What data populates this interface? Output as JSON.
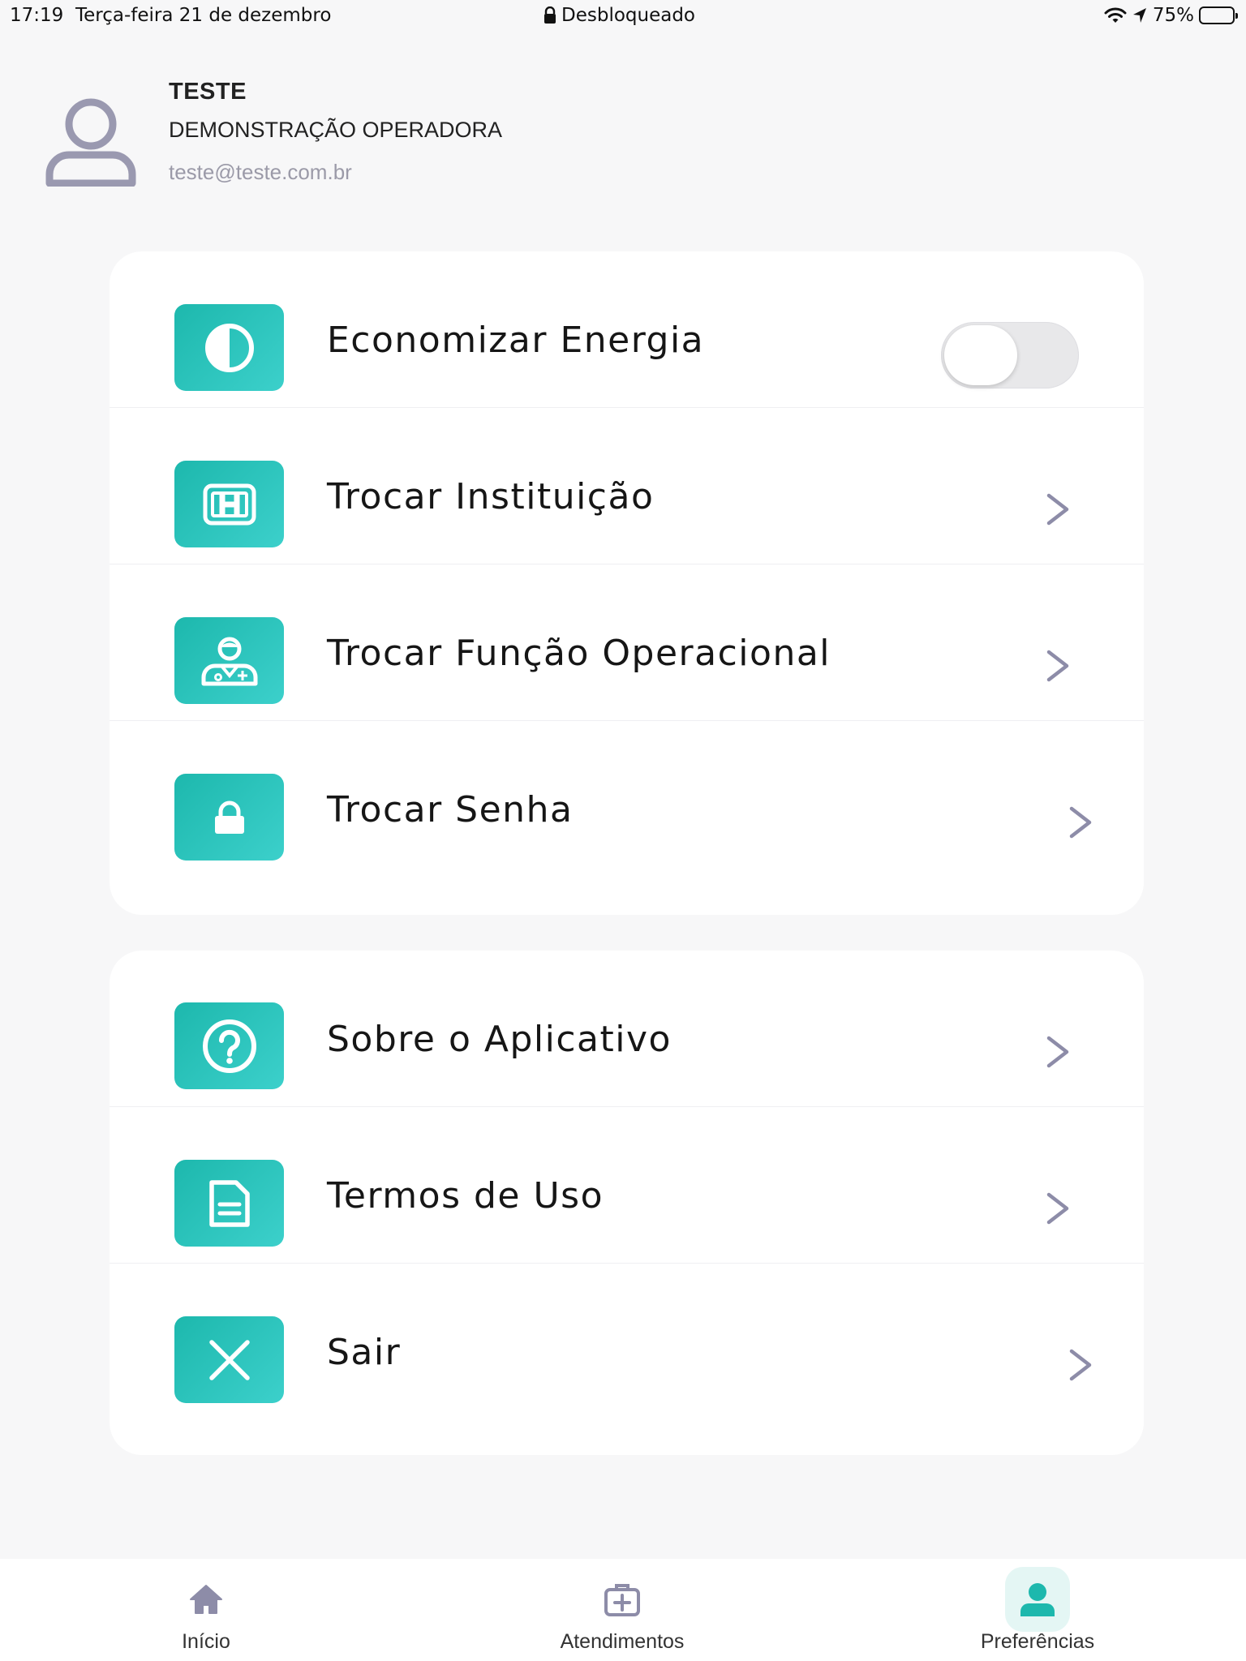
{
  "status_bar": {
    "time": "17:19",
    "date": "Terça-feira 21 de dezembro",
    "lock_status": "Desbloqueado",
    "battery": "75%",
    "battery_level": 0.75
  },
  "profile": {
    "name": "TESTE",
    "organization": "DEMONSTRAÇÃO OPERADORA",
    "email": "teste@teste.com.br"
  },
  "colors": {
    "accent": "#1db8ad",
    "accent_light": "#3cd0cb",
    "chevron": "#8d8ca8",
    "avatar": "#9a99b0"
  },
  "settings_group_1": [
    {
      "label": "Economizar Energia",
      "icon": "half-circle-icon",
      "control": "toggle",
      "toggle_on": false
    },
    {
      "label": "Trocar Instituição",
      "icon": "hospital-icon",
      "control": "chevron"
    },
    {
      "label": "Trocar Função Operacional",
      "icon": "doctor-icon",
      "control": "chevron"
    },
    {
      "label": "Trocar Senha",
      "icon": "lock-icon",
      "control": "chevron"
    }
  ],
  "settings_group_2": [
    {
      "label": "Sobre o Aplicativo",
      "icon": "question-icon",
      "control": "chevron"
    },
    {
      "label": "Termos de Uso",
      "icon": "document-icon",
      "control": "chevron"
    },
    {
      "label": "Sair",
      "icon": "close-icon",
      "control": "chevron"
    }
  ],
  "tab_bar": [
    {
      "label": "Início",
      "icon": "home-icon",
      "active": false
    },
    {
      "label": "Atendimentos",
      "icon": "medical-kit-icon",
      "active": false
    },
    {
      "label": "Preferências",
      "icon": "user-icon",
      "active": true
    }
  ]
}
